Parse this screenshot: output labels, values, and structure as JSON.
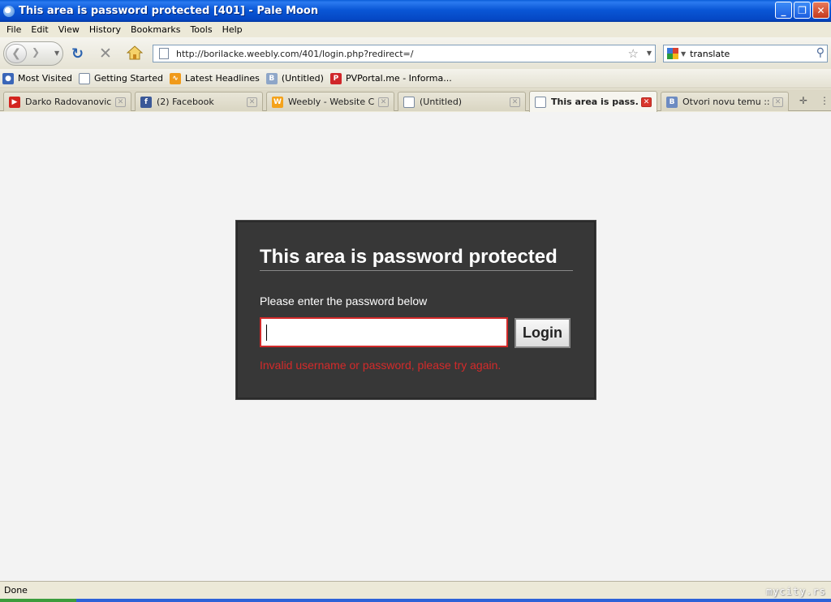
{
  "window": {
    "title": "This area is password protected [401] - Pale Moon",
    "controls": {
      "minimize": "_",
      "maximize": "❐",
      "close": "✕"
    }
  },
  "menu": [
    "File",
    "Edit",
    "View",
    "History",
    "Bookmarks",
    "Tools",
    "Help"
  ],
  "nav": {
    "url": "http://borilacke.weebly.com/401/login.php?redirect=/",
    "search_value": "translate",
    "search_engine_icon": "google-icon"
  },
  "bookmarks": [
    {
      "label": "Most Visited",
      "icon": "most-visited-icon"
    },
    {
      "label": "Getting Started",
      "icon": "page-icon"
    },
    {
      "label": "Latest Headlines",
      "icon": "rss-icon"
    },
    {
      "label": "(Untitled)",
      "icon": "weebly-favicon"
    },
    {
      "label": "PVPortal.me - Informa...",
      "icon": "pvportal-favicon"
    }
  ],
  "tabs": [
    {
      "label": "Darko Radovanovic ...",
      "icon": "youtube-favicon",
      "active": false
    },
    {
      "label": "(2) Facebook",
      "icon": "facebook-favicon",
      "active": false
    },
    {
      "label": "Weebly - Website Cr...",
      "icon": "weebly-favicon",
      "active": false
    },
    {
      "label": "(Untitled)",
      "icon": "page-icon",
      "active": false
    },
    {
      "label": "This area is pass...",
      "icon": "page-icon",
      "active": true
    },
    {
      "label": "Otvori novu temu :: ...",
      "icon": "forum-favicon",
      "active": false
    }
  ],
  "login": {
    "title": "This area is password protected",
    "prompt": "Please enter the password below",
    "button_label": "Login",
    "error": "Invalid username or password, please try again.",
    "password_value": ""
  },
  "status": {
    "text": "Done",
    "watermark": "mycity.rs"
  },
  "colors": {
    "titlebar": "#0a57d6",
    "login_panel": "#373737",
    "error": "#d42a2a",
    "input_border_error": "#d22a2a"
  }
}
